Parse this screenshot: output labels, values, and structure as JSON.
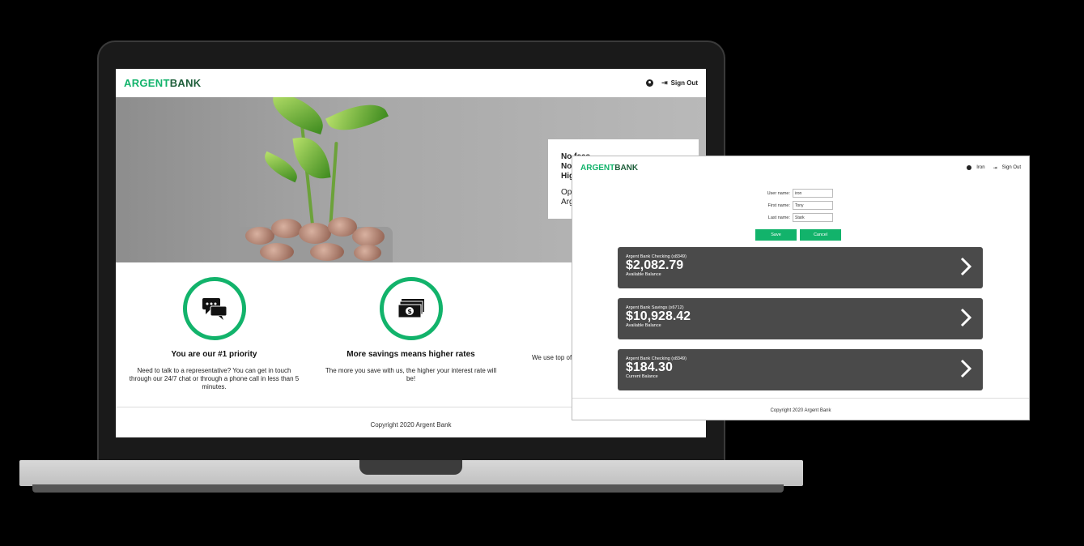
{
  "main": {
    "logo": {
      "part1": "ARGENT",
      "part2": "BANK"
    },
    "signout_label": "Sign Out",
    "promo": {
      "line1": "No fees",
      "line2": "No",
      "line3": "Hig",
      "line4": "Op",
      "line5": "Arg"
    },
    "features": [
      {
        "title": "You are our #1 priority",
        "text": "Need to talk to a representative? You can get in touch through our 24/7 chat or through a phone call in less than 5 minutes.",
        "icon": "chat-icon"
      },
      {
        "title": "More savings means higher rates",
        "text": "The more you save with us, the higher your interest rate will be!",
        "icon": "cash-icon"
      },
      {
        "title": "",
        "text": "We use top of",
        "icon": ""
      }
    ],
    "footer": "Copyright 2020 Argent Bank"
  },
  "overlay": {
    "logo": {
      "part1": "ARGENT",
      "part2": "BANK"
    },
    "user_name": "Iron",
    "signout_label": "Sign Out",
    "form": {
      "username_label": "User name:",
      "username_value": "iron",
      "firstname_label": "First name:",
      "firstname_value": "Tony",
      "lastname_label": "Last name:",
      "lastname_value": "Stark"
    },
    "save_label": "Save",
    "cancel_label": "Cancel",
    "accounts": [
      {
        "name": "Argent Bank Checking (x8349)",
        "balance": "$2,082.79",
        "label": "Available Balance"
      },
      {
        "name": "Argent Bank Savings (x6712)",
        "balance": "$10,928.42",
        "label": "Available Balance"
      },
      {
        "name": "Argent Bank Checking (x8349)",
        "balance": "$184.30",
        "label": "Current Balance"
      }
    ],
    "footer": "Copyright 2020 Argent Bank"
  },
  "colors": {
    "accent": "#12b36b",
    "brand_dark": "#1e5e3a",
    "account_bg": "#4a4a4a"
  }
}
